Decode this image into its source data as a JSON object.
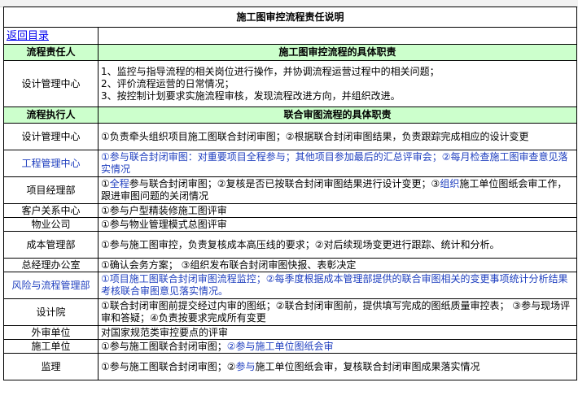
{
  "title": "施工图审控流程责任说明",
  "back_link": "返回目录",
  "section1": {
    "col_role": "流程责任人",
    "col_duty": "施工图审控流程的具体职责",
    "rows": [
      {
        "dept": "设计管理中心",
        "lines": [
          "1、监控与指导流程的相关岗位进行操作，并协调流程运营过程中的相关问题；",
          "2、评价流程运营的日常情况；",
          "3、按控制计划要求实施流程审核，发现流程改进方向，并组织改进。"
        ]
      }
    ]
  },
  "section2": {
    "col_role": "流程执行人",
    "col_duty": "联合审图流程的具体职责",
    "rows": [
      {
        "dept": "设计管理中心",
        "dept_blue": false,
        "parts": [
          {
            "t": "①负责牵头组织项目施工图联合封闭审图；②根据联合封闭审图结果，负责跟踪完成相应的设计变更",
            "blue": false
          }
        ]
      },
      {
        "dept": "工程管理中心",
        "dept_blue": true,
        "parts": [
          {
            "t": "①参与联合封闭审图：对重要项目全程参与；其他项目参加最后的汇总评审会；②每月检查施工图审查意见落实情况",
            "blue": true
          }
        ]
      },
      {
        "dept": "项目经理部",
        "dept_blue": false,
        "parts": [
          {
            "t": "①",
            "blue": false
          },
          {
            "t": "全程",
            "blue": true
          },
          {
            "t": "参与联合封闭审图；②复核是否已按联合封闭审图结果进行设计变更；③",
            "blue": false
          },
          {
            "t": "组织",
            "blue": true
          },
          {
            "t": "施工单位图纸会审工作，跟进审图问题的关闭情况",
            "blue": false
          }
        ]
      },
      {
        "dept": "客户关系中心",
        "dept_blue": false,
        "parts": [
          {
            "t": "①参与户型精装修施工图评审",
            "blue": false
          }
        ]
      },
      {
        "dept": "物业公司",
        "dept_blue": false,
        "parts": [
          {
            "t": "①参与物业管理模式总图评审",
            "blue": false
          }
        ]
      },
      {
        "dept": "成本管理部",
        "dept_blue": false,
        "parts": [
          {
            "t": "①参与施工图审控，负责复核成本高压线的要求；②对后续现场变更进行跟踪、统计和分析。",
            "blue": false
          }
        ]
      },
      {
        "dept": "总经理办公室",
        "dept_blue": false,
        "parts": [
          {
            "t": "①确认会务方案； ③组织发布联合封闭审图快报、表彰决定",
            "blue": false
          }
        ]
      },
      {
        "dept": "风险与流程管理部",
        "dept_blue": true,
        "parts": [
          {
            "t": "①项目施工图联合封闭审图流程监控；②每季度根据成本管理部提供的联合审图相关的变更事项统计分析结果考核联合审图意见落实情况。",
            "blue": true
          }
        ]
      },
      {
        "dept": "设计院",
        "dept_blue": false,
        "parts": [
          {
            "t": "①联合封闭审图前提交经过内审的图纸；②联合封闭审图前，提供填写完成的图纸质量审控表； ③参与现场评审和答疑；④负责按要求完成所有变更",
            "blue": false
          }
        ]
      },
      {
        "dept": "外审单位",
        "dept_blue": false,
        "parts": [
          {
            "t": "对国家规范类审控要点的评审",
            "blue": false
          }
        ]
      },
      {
        "dept": "施工单位",
        "dept_blue": false,
        "parts": [
          {
            "t": "①参与施工图联合封闭审图；",
            "blue": false
          },
          {
            "t": "②参与施工单位图纸会审",
            "blue": true
          }
        ]
      },
      {
        "dept": "监理",
        "dept_blue": false,
        "parts": [
          {
            "t": "①参与施工图联合封闭审图；②",
            "blue": false
          },
          {
            "t": "参与",
            "blue": true
          },
          {
            "t": "施工单位图纸会审，复核联合封闭审图成果落实情况",
            "blue": false
          }
        ]
      }
    ]
  },
  "colors": {
    "header_bg": "#ccffcc",
    "link": "#0000ee",
    "highlight_text": "#1f3fbf",
    "border": "#000000"
  }
}
